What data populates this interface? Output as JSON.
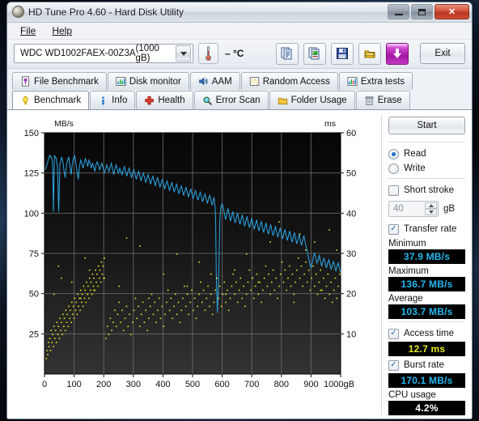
{
  "window": {
    "title": "HD Tune Pro 4.60 - Hard Disk Utility",
    "icon": "hard-disk-icon",
    "minimize": "–",
    "maximize": "□",
    "close": "✕"
  },
  "menu": {
    "items": [
      "File",
      "Help"
    ]
  },
  "toolbar": {
    "drive_name": "WDC WD1002FAEX-00Z3A",
    "drive_capacity": "(1000 gB)",
    "temperature": "– °C",
    "buttons": [
      {
        "name": "copy-text-icon"
      },
      {
        "name": "copy-image-icon"
      },
      {
        "name": "save-icon"
      },
      {
        "name": "folder-gold-icon"
      },
      {
        "name": "download-arrow-icon"
      }
    ],
    "exit_label": "Exit"
  },
  "tabs": {
    "row1": [
      {
        "label": "File Benchmark",
        "icon": "file-benchmark-icon",
        "active": false
      },
      {
        "label": "Disk monitor",
        "icon": "disk-monitor-icon",
        "active": false
      },
      {
        "label": "AAM",
        "icon": "speaker-icon",
        "active": false
      },
      {
        "label": "Random Access",
        "icon": "random-access-icon",
        "active": false
      },
      {
        "label": "Extra tests",
        "icon": "extra-tests-icon",
        "active": false
      }
    ],
    "row2": [
      {
        "label": "Benchmark",
        "icon": "benchmark-icon",
        "active": true
      },
      {
        "label": "Info",
        "icon": "info-icon",
        "active": false
      },
      {
        "label": "Health",
        "icon": "health-cross-icon",
        "active": false
      },
      {
        "label": "Error Scan",
        "icon": "magnifier-icon",
        "active": false
      },
      {
        "label": "Folder Usage",
        "icon": "folder-icon",
        "active": false
      },
      {
        "label": "Erase",
        "icon": "trash-icon",
        "active": false
      }
    ]
  },
  "side_panel": {
    "start_label": "Start",
    "mode_read": "Read",
    "mode_write": "Write",
    "mode_selected": "Read",
    "short_stroke_label": "Short stroke",
    "short_stroke_checked": false,
    "short_stroke_value": "40",
    "short_stroke_unit": "gB",
    "transfer_rate_label": "Transfer rate",
    "transfer_rate_checked": true,
    "minimum_label": "Minimum",
    "minimum_value": "37.9 MB/s",
    "maximum_label": "Maximum",
    "maximum_value": "136.7 MB/s",
    "average_label": "Average",
    "average_value": "103.7 MB/s",
    "access_time_label": "Access time",
    "access_time_checked": true,
    "access_time_value": "12.7 ms",
    "burst_rate_label": "Burst rate",
    "burst_rate_checked": true,
    "burst_rate_value": "170.1 MB/s",
    "cpu_usage_label": "CPU usage",
    "cpu_usage_value": "4.2%"
  },
  "chart_data": {
    "type": "line",
    "title": "",
    "xlabel": "gB",
    "ylabel": "MB/s",
    "y2label": "ms",
    "xlim": [
      0,
      1000
    ],
    "ylim": [
      0,
      150
    ],
    "y2lim": [
      0,
      60
    ],
    "grid": true,
    "xticks": [
      0,
      100,
      200,
      300,
      400,
      500,
      600,
      700,
      800,
      900,
      1000
    ],
    "yticks": [
      25,
      50,
      75,
      100,
      125,
      150
    ],
    "y2ticks": [
      10,
      20,
      30,
      40,
      50,
      60
    ],
    "colors": {
      "transfer": "#2aa8e8",
      "access": "#e8e81c",
      "background": "#0a0a0a",
      "grid": "#6b6b6b"
    },
    "series": [
      {
        "name": "Transfer rate",
        "units": "MB/s",
        "axis": "left",
        "color": "#2aa8e8",
        "x": [
          2,
          8,
          14,
          18,
          22,
          26,
          28,
          30,
          32,
          34,
          36,
          40,
          44,
          48,
          52,
          56,
          58,
          62,
          66,
          70,
          74,
          78,
          82,
          86,
          90,
          94,
          98,
          102,
          106,
          110,
          114,
          118,
          122,
          126,
          130,
          134,
          138,
          142,
          146,
          150,
          154,
          158,
          162,
          166,
          170,
          174,
          178,
          182,
          186,
          190,
          194,
          198,
          202,
          206,
          210,
          214,
          218,
          222,
          226,
          230,
          234,
          238,
          242,
          246,
          250,
          254,
          258,
          262,
          266,
          270,
          274,
          278,
          282,
          286,
          290,
          294,
          298,
          302,
          306,
          310,
          314,
          318,
          322,
          326,
          330,
          334,
          338,
          342,
          346,
          350,
          354,
          358,
          362,
          366,
          370,
          374,
          378,
          382,
          386,
          390,
          394,
          398,
          402,
          406,
          410,
          414,
          418,
          422,
          426,
          430,
          434,
          438,
          442,
          446,
          450,
          454,
          458,
          462,
          466,
          470,
          474,
          478,
          482,
          486,
          490,
          494,
          498,
          502,
          506,
          510,
          514,
          518,
          522,
          526,
          530,
          534,
          538,
          542,
          546,
          550,
          554,
          558,
          562,
          566,
          570,
          572,
          574,
          576,
          578,
          580,
          584,
          588,
          592,
          596,
          600,
          604,
          608,
          612,
          616,
          620,
          624,
          628,
          632,
          636,
          640,
          644,
          648,
          652,
          656,
          660,
          664,
          668,
          672,
          676,
          680,
          684,
          688,
          692,
          696,
          700,
          704,
          708,
          712,
          716,
          720,
          724,
          728,
          732,
          736,
          740,
          744,
          748,
          752,
          756,
          760,
          764,
          768,
          772,
          776,
          780,
          784,
          788,
          792,
          796,
          800,
          804,
          808,
          812,
          816,
          820,
          824,
          828,
          832,
          836,
          840,
          844,
          848,
          852,
          856,
          860,
          864,
          868,
          872,
          876,
          880,
          884,
          888,
          892,
          896,
          900,
          904,
          908,
          912,
          916,
          920,
          924,
          928,
          932,
          936,
          940,
          944,
          948,
          952,
          956,
          960,
          964,
          968,
          972,
          976,
          980,
          984,
          988,
          992,
          996,
          1000
        ],
        "y": [
          127,
          130,
          134,
          136,
          135,
          133,
          128,
          101,
          121,
          136,
          135,
          134,
          128,
          101,
          131,
          133,
          135,
          132,
          126,
          122,
          130,
          133,
          135,
          129,
          124,
          131,
          134,
          136,
          131,
          126,
          121,
          129,
          133,
          131,
          128,
          131,
          134,
          132,
          129,
          133,
          131,
          128,
          131,
          129,
          126,
          130,
          132,
          130,
          127,
          129,
          131,
          128,
          125,
          127,
          130,
          128,
          126,
          129,
          131,
          127,
          124,
          128,
          130,
          127,
          125,
          128,
          126,
          124,
          127,
          129,
          126,
          123,
          126,
          128,
          125,
          122,
          125,
          127,
          124,
          121,
          124,
          126,
          123,
          120,
          123,
          125,
          122,
          119,
          122,
          124,
          121,
          118,
          121,
          123,
          120,
          117,
          120,
          122,
          119,
          116,
          119,
          121,
          118,
          115,
          118,
          120,
          117,
          114,
          117,
          119,
          116,
          113,
          116,
          118,
          115,
          112,
          115,
          117,
          114,
          111,
          114,
          116,
          113,
          110,
          113,
          115,
          112,
          109,
          112,
          114,
          111,
          108,
          111,
          113,
          110,
          107,
          110,
          112,
          109,
          106,
          109,
          111,
          108,
          105,
          108,
          110,
          107,
          104,
          97,
          62,
          38,
          58,
          96,
          104,
          106,
          103,
          99,
          96,
          100,
          103,
          99,
          95,
          98,
          101,
          97,
          94,
          97,
          100,
          96,
          93,
          96,
          99,
          95,
          92,
          95,
          98,
          94,
          91,
          94,
          97,
          93,
          90,
          93,
          96,
          92,
          89,
          92,
          95,
          91,
          88,
          91,
          94,
          90,
          87,
          90,
          93,
          89,
          86,
          89,
          92,
          88,
          85,
          88,
          91,
          87,
          84,
          87,
          90,
          86,
          83,
          86,
          89,
          85,
          82,
          85,
          88,
          84,
          81,
          84,
          87,
          83,
          80,
          83,
          86,
          82,
          79,
          76,
          72,
          68,
          66,
          69,
          73,
          75,
          72,
          69,
          71,
          74,
          70,
          67,
          70,
          72,
          69,
          66,
          69,
          71,
          68,
          65,
          68,
          70,
          67,
          64,
          67,
          69,
          66,
          63,
          66,
          68,
          65,
          62,
          65,
          67,
          64,
          61,
          64,
          66,
          63,
          60,
          63,
          65
        ]
      },
      {
        "name": "Access time",
        "units": "ms",
        "axis": "right",
        "color": "#e8e81c",
        "marker": "dot",
        "x": [
          4,
          6,
          9,
          11,
          13,
          16,
          18,
          20,
          23,
          25,
          28,
          30,
          33,
          35,
          38,
          40,
          43,
          45,
          48,
          50,
          53,
          55,
          58,
          60,
          63,
          65,
          68,
          70,
          73,
          75,
          78,
          80,
          83,
          85,
          88,
          90,
          93,
          95,
          98,
          100,
          103,
          105,
          108,
          110,
          113,
          115,
          118,
          120,
          123,
          125,
          128,
          130,
          133,
          135,
          138,
          140,
          143,
          145,
          148,
          150,
          153,
          155,
          158,
          160,
          163,
          165,
          168,
          170,
          173,
          175,
          178,
          180,
          183,
          185,
          188,
          190,
          193,
          195,
          198,
          200,
          205,
          210,
          215,
          220,
          225,
          230,
          235,
          240,
          245,
          250,
          255,
          260,
          265,
          270,
          275,
          280,
          285,
          290,
          295,
          300,
          305,
          310,
          315,
          320,
          325,
          330,
          335,
          340,
          345,
          350,
          355,
          360,
          365,
          370,
          375,
          380,
          385,
          390,
          395,
          400,
          405,
          410,
          415,
          420,
          425,
          430,
          435,
          440,
          445,
          450,
          455,
          460,
          465,
          470,
          475,
          480,
          485,
          490,
          495,
          500,
          505,
          510,
          515,
          520,
          525,
          530,
          535,
          540,
          545,
          550,
          555,
          560,
          565,
          570,
          575,
          580,
          585,
          590,
          595,
          600,
          605,
          610,
          615,
          620,
          625,
          630,
          635,
          640,
          645,
          650,
          655,
          660,
          665,
          670,
          675,
          680,
          685,
          690,
          695,
          700,
          705,
          710,
          715,
          720,
          725,
          730,
          735,
          740,
          745,
          750,
          755,
          760,
          765,
          770,
          775,
          780,
          785,
          790,
          795,
          800,
          805,
          810,
          815,
          820,
          825,
          830,
          835,
          840,
          845,
          850,
          855,
          860,
          865,
          870,
          875,
          880,
          885,
          890,
          895,
          900,
          905,
          910,
          915,
          920,
          925,
          930,
          935,
          940,
          945,
          950,
          955,
          960,
          965,
          970,
          975,
          980,
          985,
          990,
          995,
          30,
          90,
          150,
          165,
          55,
          120,
          250,
          400,
          610,
          720,
          840,
          930,
          200,
          350,
          480,
          560,
          680,
          760,
          880,
          960,
          45,
          135,
          275,
          320,
          445,
          520,
          640,
          700,
          790,
          860,
          910,
          985
        ],
        "y": [
          4,
          6,
          5,
          8,
          7,
          9,
          6,
          11,
          8,
          10,
          7,
          12,
          9,
          11,
          8,
          13,
          10,
          12,
          9,
          14,
          11,
          13,
          10,
          15,
          12,
          14,
          11,
          16,
          13,
          15,
          12,
          17,
          14,
          16,
          13,
          18,
          15,
          17,
          14,
          19,
          16,
          18,
          15,
          20,
          17,
          19,
          16,
          21,
          18,
          20,
          17,
          22,
          19,
          21,
          18,
          23,
          20,
          22,
          19,
          24,
          21,
          23,
          20,
          25,
          22,
          24,
          21,
          26,
          23,
          25,
          22,
          27,
          24,
          26,
          23,
          28,
          25,
          27,
          24,
          29,
          9,
          12,
          10,
          14,
          11,
          13,
          16,
          12,
          15,
          18,
          13,
          16,
          11,
          14,
          17,
          12,
          15,
          10,
          13,
          16,
          19,
          14,
          17,
          12,
          15,
          18,
          13,
          16,
          11,
          14,
          17,
          20,
          15,
          18,
          13,
          16,
          19,
          14,
          17,
          12,
          15,
          18,
          21,
          16,
          19,
          14,
          17,
          20,
          15,
          18,
          13,
          16,
          19,
          22,
          17,
          20,
          15,
          18,
          21,
          16,
          19,
          14,
          17,
          20,
          23,
          18,
          21,
          16,
          19,
          22,
          17,
          20,
          15,
          18,
          21,
          24,
          19,
          22,
          17,
          20,
          23,
          18,
          21,
          16,
          19,
          22,
          25,
          20,
          23,
          18,
          21,
          24,
          19,
          22,
          17,
          20,
          23,
          26,
          21,
          24,
          19,
          22,
          25,
          20,
          23,
          18,
          21,
          24,
          27,
          22,
          25,
          20,
          23,
          26,
          21,
          24,
          19,
          22,
          25,
          28,
          23,
          26,
          21,
          24,
          27,
          22,
          25,
          20,
          23,
          26,
          29,
          24,
          27,
          22,
          25,
          28,
          23,
          26,
          21,
          24,
          27,
          22,
          25,
          20,
          23,
          26,
          21,
          24,
          19,
          22,
          25,
          20,
          23,
          18,
          21,
          24,
          19,
          22,
          25,
          20,
          23,
          26,
          21,
          24,
          19,
          22,
          25,
          20,
          23,
          18,
          21,
          24,
          19,
          22,
          25,
          30,
          33,
          31,
          36,
          27,
          29,
          34,
          32,
          30,
          28,
          26,
          24,
          38,
          35,
          33,
          31,
          29,
          27,
          25,
          23,
          19,
          21,
          23,
          20,
          22,
          24,
          18,
          20,
          17,
          19,
          16,
          18
        ]
      }
    ]
  }
}
